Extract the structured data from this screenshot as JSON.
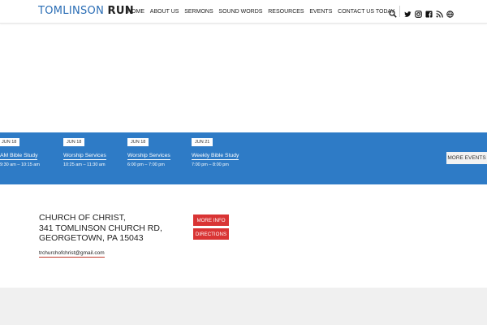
{
  "header": {
    "logo_part1": "TOMLINSON",
    "logo_part2": "RUN",
    "nav": [
      "HOME",
      "ABOUT US",
      "SERMONS",
      "SOUND WORDS",
      "RESOURCES",
      "EVENTS",
      "CONTACT US TODAY"
    ],
    "icons": [
      "search-icon",
      "twitter-icon",
      "instagram-icon",
      "facebook-icon",
      "rss-icon",
      "globe-icon"
    ]
  },
  "events": {
    "items": [
      {
        "date": "JUN 18",
        "title": "AM Bible Study",
        "time": "9:30 am – 10:15 am"
      },
      {
        "date": "JUN 18",
        "title": "Worship Services",
        "time": "10:25 am – 11:30 am"
      },
      {
        "date": "JUN 18",
        "title": "Worship Services",
        "time": "6:00 pm – 7:00 pm"
      },
      {
        "date": "JUN 21",
        "title": "Weekly Bible Study",
        "time": "7:00 pm – 8:00 pm"
      }
    ],
    "more_label": "MORE EVENTS"
  },
  "address": {
    "lines": [
      "CHURCH OF CHRIST,",
      "341 TOMLINSON CHURCH RD,",
      "GEORGETOWN, PA 15043"
    ],
    "email": "trchurchofchrist@gmail.com",
    "more_info_label": "MORE INFO",
    "directions_label": "DIRECTIONS"
  },
  "colors": {
    "brand_blue": "#2e7bc6",
    "button_red": "#d93434",
    "footer_gray": "#f0f0f0"
  }
}
